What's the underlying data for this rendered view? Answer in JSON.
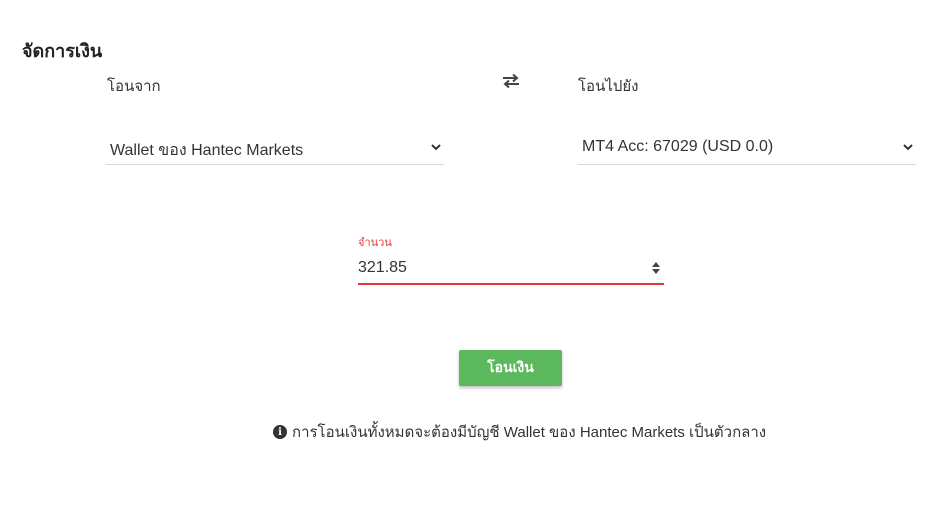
{
  "page": {
    "title": "จัดการเงิน"
  },
  "transfer": {
    "from_label": "โอนจาก",
    "to_label": "โอนไปยัง",
    "from_selected": "Wallet ของ Hantec Markets",
    "to_selected": "MT4 Acc: 67029 (USD 0.0)",
    "swap_icon": "swap-arrows-icon"
  },
  "amount": {
    "label": "จำนวน",
    "value": "321.85",
    "accent_color": "#e53935"
  },
  "actions": {
    "submit_label": "โอนเงิน",
    "submit_color": "#5cb85c"
  },
  "note": {
    "icon": "info-icon",
    "text": "การโอนเงินทั้งหมดจะต้องมีบัญชี Wallet ของ Hantec Markets เป็นตัวกลาง"
  }
}
